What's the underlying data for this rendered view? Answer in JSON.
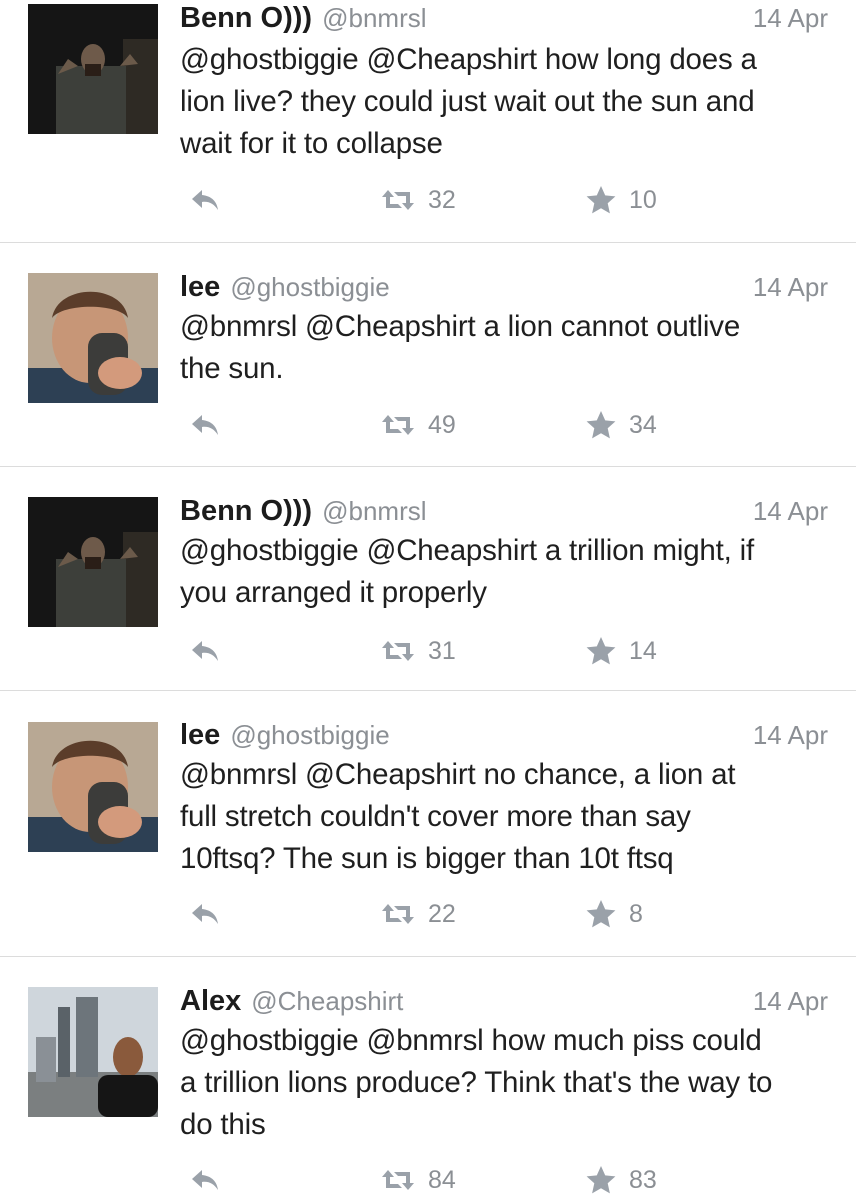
{
  "colors": {
    "meta": "#8b8f94",
    "icon": "#9aa1a9",
    "divider": "#dcdcdc",
    "text": "#1f1f1f"
  },
  "icons": {
    "reply": "reply-arrow-icon",
    "retweet": "retweet-icon",
    "favorite": "star-icon"
  },
  "tweets": [
    {
      "name": "Benn O)))",
      "handle": "@bnmrsl",
      "time": "14 Apr",
      "lines": [
        "@ghostbiggie @Cheapshirt how long does a",
        "lion live? they could just wait out the sun and",
        "wait for it to collapse"
      ],
      "retweets": "32",
      "favorites": "10"
    },
    {
      "name": "lee",
      "handle": "@ghostbiggie",
      "time": "14 Apr",
      "lines": [
        "@bnmrsl @Cheapshirt a lion cannot outlive",
        "the sun."
      ],
      "retweets": "49",
      "favorites": "34"
    },
    {
      "name": "Benn O)))",
      "handle": "@bnmrsl",
      "time": "14 Apr",
      "lines": [
        "@ghostbiggie @Cheapshirt a trillion might, if",
        "you arranged it properly"
      ],
      "retweets": "31",
      "favorites": "14"
    },
    {
      "name": "lee",
      "handle": "@ghostbiggie",
      "time": "14 Apr",
      "lines": [
        "@bnmrsl @Cheapshirt no chance, a lion at",
        "full stretch couldn't cover more than say",
        "10ftsq? The sun is bigger than 10t ftsq"
      ],
      "retweets": "22",
      "favorites": "8"
    },
    {
      "name": "Alex",
      "handle": "@Cheapshirt",
      "time": "14 Apr",
      "lines": [
        "@ghostbiggie @bnmrsl how much piss could",
        "a trillion lions produce? Think that's the way to",
        "do this"
      ],
      "retweets": "84",
      "favorites": "83"
    }
  ]
}
